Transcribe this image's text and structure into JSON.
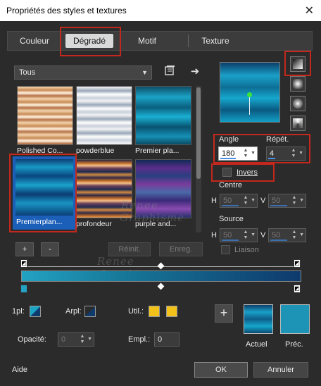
{
  "window": {
    "title": "Propriétés des styles et textures"
  },
  "tabs": [
    {
      "label": "Couleur"
    },
    {
      "label": "Dégradé"
    },
    {
      "label": "Motif"
    },
    {
      "label": "Texture"
    }
  ],
  "gradient_category": "Tous",
  "thumbnails": [
    {
      "label": "Polished Co..."
    },
    {
      "label": "powderblue"
    },
    {
      "label": "Premier pla..."
    },
    {
      "label": "Premierplan..."
    },
    {
      "label": "profondeur"
    },
    {
      "label": "purple and..."
    }
  ],
  "buttons": {
    "add": "+",
    "remove": "-",
    "reset": "Réinit.",
    "save": "Enreg.",
    "help": "Aide",
    "ok": "OK",
    "cancel": "Annuler"
  },
  "angle": {
    "label": "Angle",
    "value": "180"
  },
  "repeat": {
    "label": "Répét.",
    "value": "4"
  },
  "invert": {
    "label": "Invers"
  },
  "center": {
    "label": "Centre",
    "h_label": "H",
    "h_value": "50",
    "v_label": "V",
    "v_value": "50"
  },
  "source": {
    "label": "Source",
    "h_label": "H",
    "h_value": "50",
    "v_label": "V",
    "v_value": "50"
  },
  "link": {
    "label": "Liaison"
  },
  "stops": {
    "fg_label": "1pl:",
    "bg_label": "Arpl:",
    "user_label": "Util.:",
    "opacity_label": "Opacité:",
    "opacity_value": "0",
    "location_label": "Empl.:",
    "location_value": "0"
  },
  "current": {
    "label": "Actuel"
  },
  "previous": {
    "label": "Préc."
  },
  "watermark": {
    "line1": "Renee",
    "line2": "Graphisme"
  },
  "colors": {
    "stop_start": "#23a2c2",
    "stop_end": "#0e3a6c",
    "user_color": "#f2c21b",
    "previous": "#1d93b6",
    "highlight": "#c4281c"
  }
}
